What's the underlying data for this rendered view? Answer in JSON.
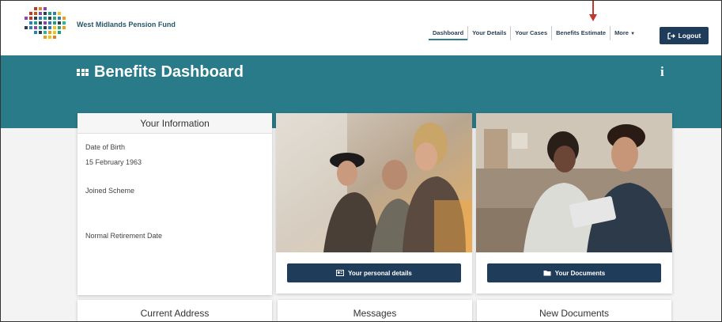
{
  "header": {
    "brand_name": "West Midlands Pension Fund",
    "nav_items": [
      {
        "label": "Dashboard",
        "active": true
      },
      {
        "label": "Your Details",
        "active": false
      },
      {
        "label": "Your Cases",
        "active": false
      },
      {
        "label": "Benefits Estimate",
        "active": false
      },
      {
        "label": "More",
        "active": false
      }
    ],
    "logout_label": "Logout"
  },
  "banner": {
    "title": "Benefits Dashboard",
    "info_label": "i"
  },
  "info_card": {
    "title": "Your Information",
    "dob_label": "Date of Birth",
    "dob_value": "15 February 1963",
    "joined_label": "Joined Scheme",
    "retirement_label": "Normal Retirement Date"
  },
  "cards": {
    "personal_details_label": "Your personal details",
    "documents_label": "Your Documents"
  },
  "bottom": {
    "address_title": "Current Address",
    "messages_title": "Messages",
    "new_docs_title": "New Documents"
  },
  "colors": {
    "teal": "#2a7b8a",
    "navy": "#1f3d5a",
    "annotation_arrow": "#c0392b"
  }
}
